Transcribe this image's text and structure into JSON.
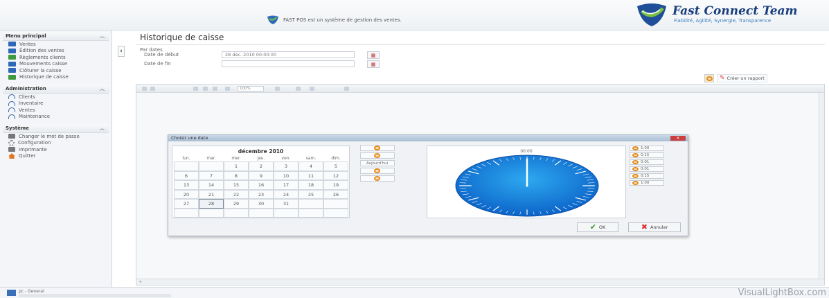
{
  "header": {
    "tagline": "FAST POS est un système de gestion des ventes.",
    "brand_name": "Fast Connect Team",
    "brand_slogan": "Fiabilité, Agilité, Synergie, Transparence"
  },
  "sidebar": {
    "groups": [
      {
        "title": "Menu principal",
        "items": [
          {
            "label": "Ventes",
            "icon": "sales-icon"
          },
          {
            "label": "Édition des ventes",
            "icon": "sales-edit-icon"
          },
          {
            "label": "Règlements clients",
            "icon": "payments-icon"
          },
          {
            "label": "Mouvements caisse",
            "icon": "cash-movement-icon"
          },
          {
            "label": "Clôturer la caisse",
            "icon": "close-register-icon"
          },
          {
            "label": "Historique de caisse",
            "icon": "history-icon"
          }
        ]
      },
      {
        "title": "Administration",
        "items": [
          {
            "label": "Clients",
            "icon": "clients-icon"
          },
          {
            "label": "Inventaire",
            "icon": "inventory-icon"
          },
          {
            "label": "Ventes",
            "icon": "sales-admin-icon"
          },
          {
            "label": "Maintenance",
            "icon": "maintenance-icon"
          }
        ]
      },
      {
        "title": "Système",
        "items": [
          {
            "label": "Changer le mot de passe",
            "icon": "password-icon"
          },
          {
            "label": "Configuration",
            "icon": "gear-icon"
          },
          {
            "label": "Imprimante",
            "icon": "printer-icon"
          },
          {
            "label": "Quitter",
            "icon": "home-icon"
          }
        ]
      }
    ]
  },
  "page": {
    "title": "Historique de caisse",
    "filter_label": "Par dates",
    "start_label": "Date de début",
    "start_value": "28 déc. 2010 00:00:00",
    "end_label": "Date de fin",
    "end_value": "",
    "report_button": "Créer un rapport",
    "zoom": "100%"
  },
  "dialog": {
    "title": "Choisir une date",
    "month": "décembre 2010",
    "weekdays": [
      "lun.",
      "mar.",
      "mer.",
      "jeu.",
      "ven.",
      "sam.",
      "dim."
    ],
    "weeks": [
      [
        "",
        "",
        "1",
        "2",
        "3",
        "4",
        "5"
      ],
      [
        "6",
        "7",
        "8",
        "9",
        "10",
        "11",
        "12"
      ],
      [
        "13",
        "14",
        "15",
        "16",
        "17",
        "18",
        "19"
      ],
      [
        "20",
        "21",
        "22",
        "23",
        "24",
        "25",
        "26"
      ],
      [
        "27",
        "28",
        "29",
        "30",
        "31",
        "",
        ""
      ],
      [
        "",
        "",
        "",
        "",
        "",
        "",
        ""
      ]
    ],
    "selected_day": "28",
    "today_button": "Aujourd'hui",
    "time": "00:00",
    "durations": [
      "1:00",
      "0:15",
      "0:01",
      "0:01",
      "0:15",
      "1:00"
    ],
    "ok_label": "OK",
    "cancel_label": "Annuler"
  },
  "statusbar": {
    "text": "pc - General"
  },
  "watermark": "VisualLightBox.com"
}
